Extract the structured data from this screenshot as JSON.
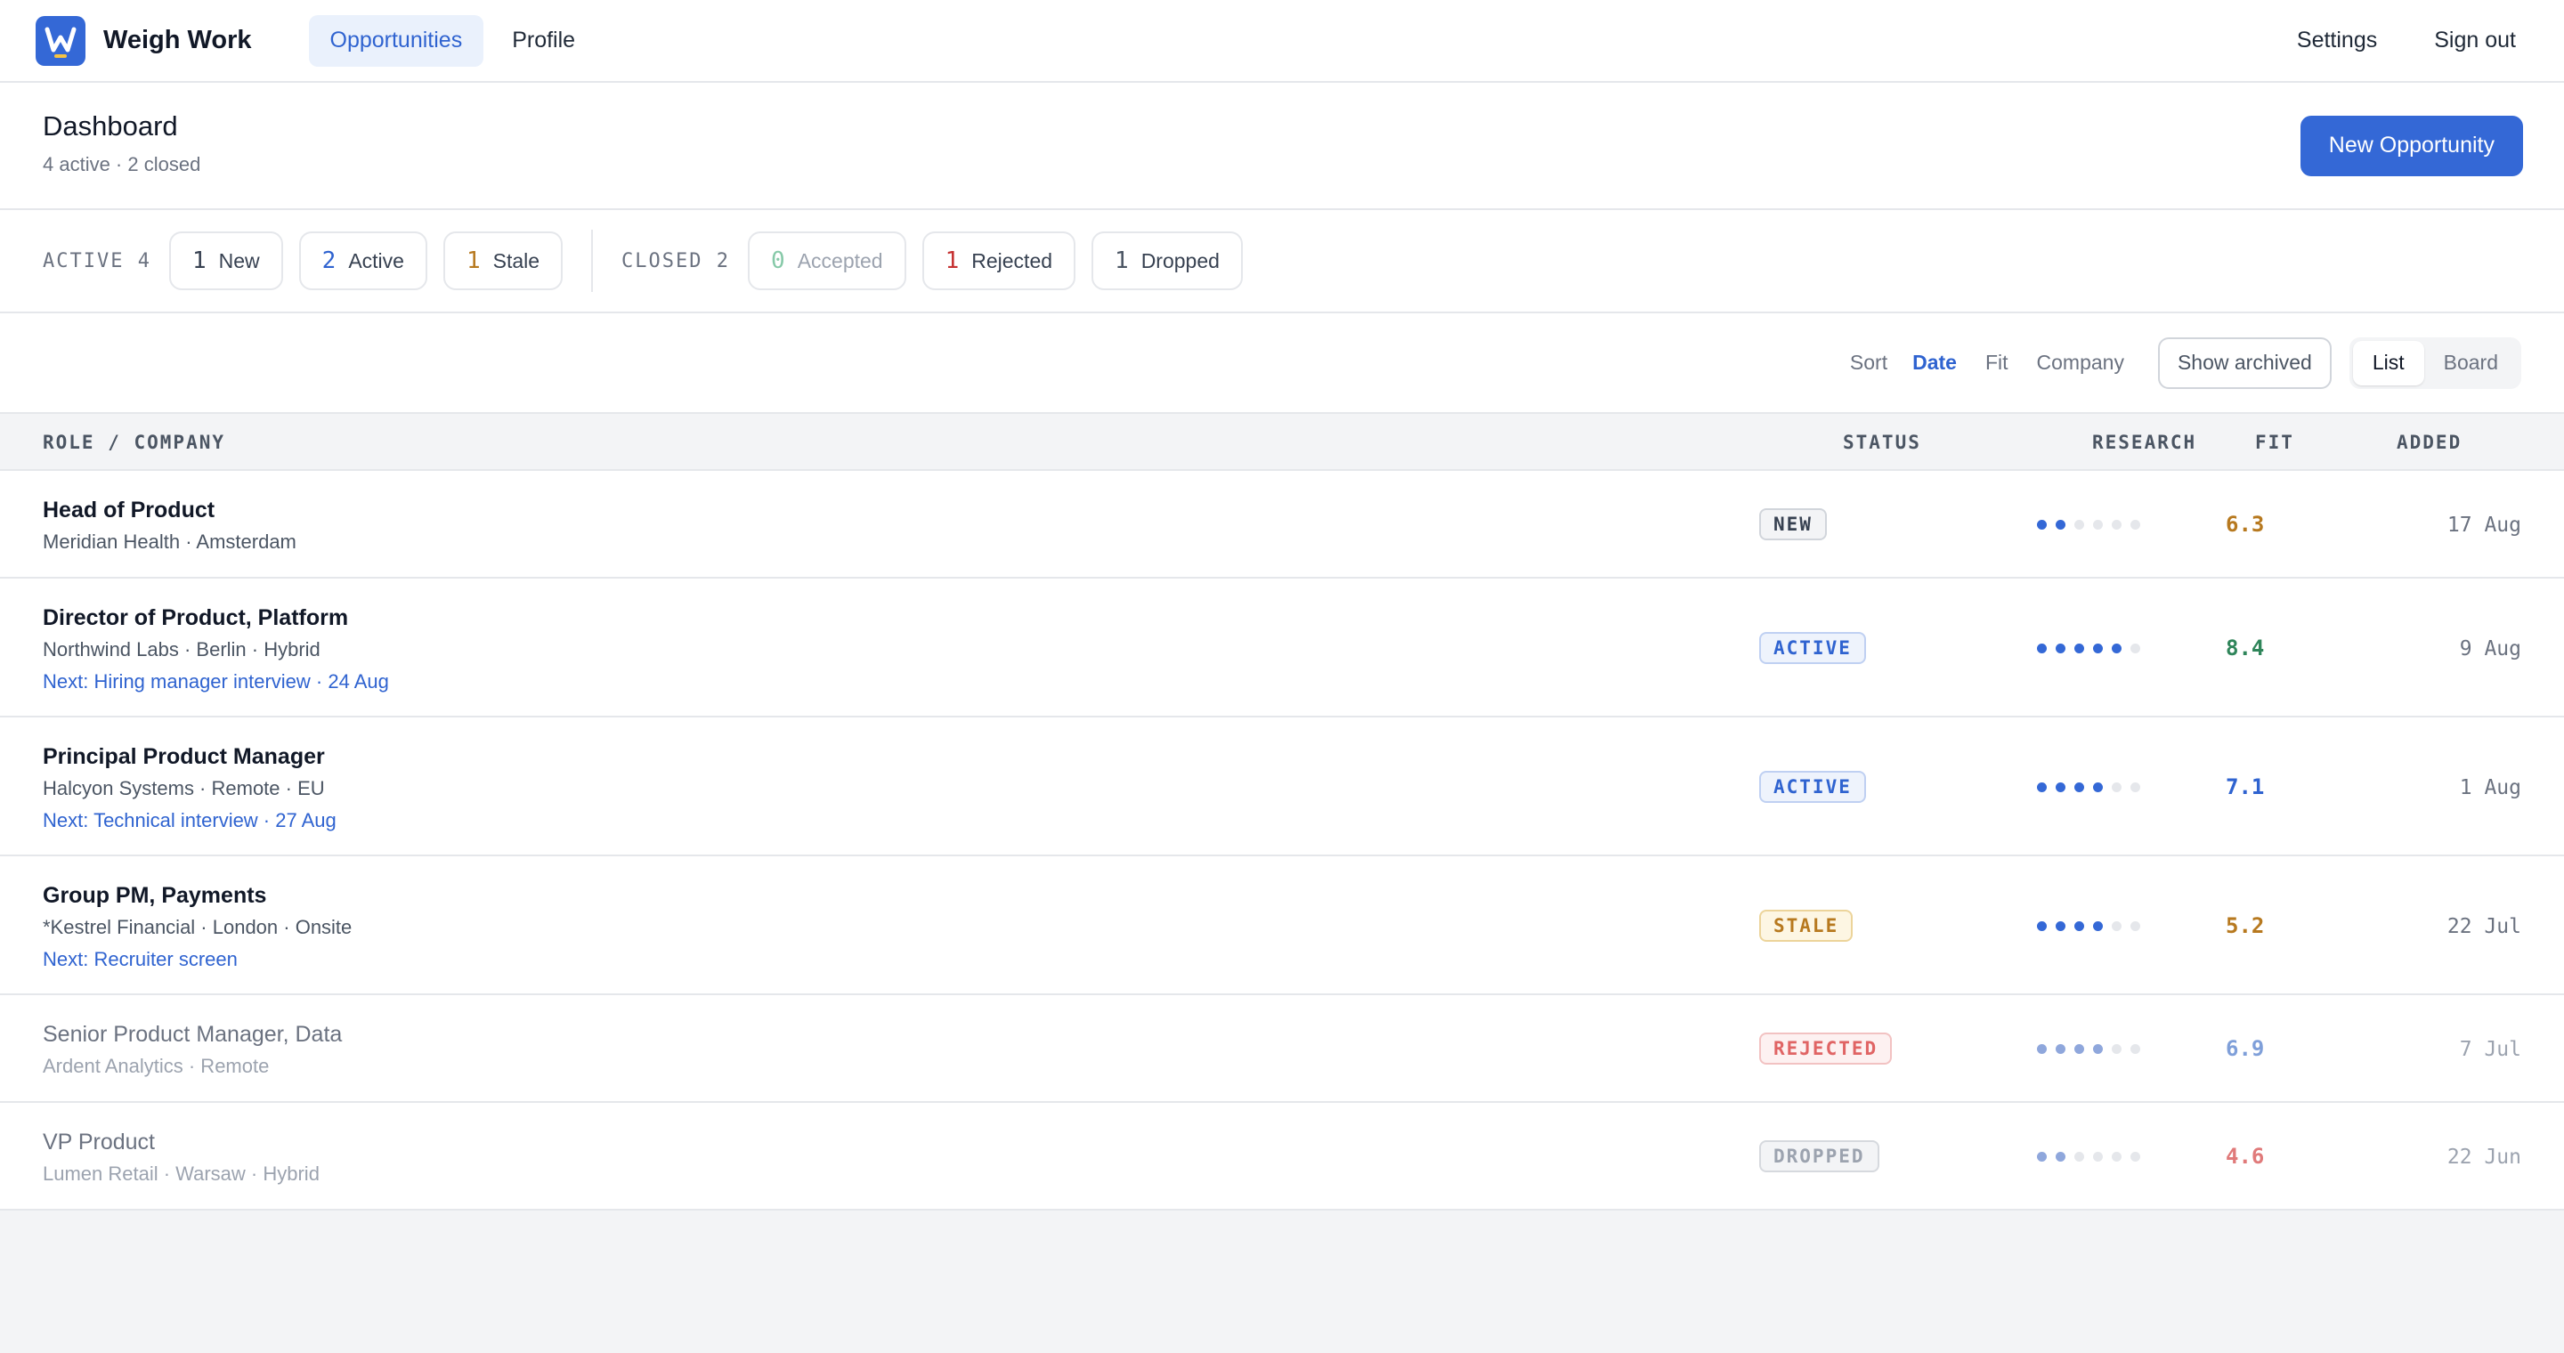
{
  "app": {
    "name": "Weigh Work",
    "logo_letter": "W",
    "brand_color": "#3468d6",
    "nav": [
      {
        "label": "Opportunities",
        "active": true
      },
      {
        "label": "Profile",
        "active": false
      }
    ],
    "top_links": [
      "Settings",
      "Sign out"
    ]
  },
  "header": {
    "title": "Dashboard",
    "subtitle": "4 active · 2 closed",
    "new_button": "New Opportunity"
  },
  "filters": {
    "active_label": "ACTIVE",
    "active_count": "4",
    "active_chips": [
      {
        "count": "1",
        "label": "New",
        "color": "#374151"
      },
      {
        "count": "2",
        "label": "Active",
        "color": "#2f63d0"
      },
      {
        "count": "1",
        "label": "Stale",
        "color": "#b7791f"
      }
    ],
    "closed_label": "CLOSED",
    "closed_count": "2",
    "closed_chips": [
      {
        "count": "0",
        "label": "Accepted",
        "color": "#86c9a8"
      },
      {
        "count": "1",
        "label": "Rejected",
        "color": "#c53030"
      },
      {
        "count": "1",
        "label": "Dropped",
        "color": "#4b5563"
      }
    ]
  },
  "toolbar": {
    "sort_label": "Sort",
    "sort_options": [
      {
        "label": "Date",
        "selected": true
      },
      {
        "label": "Fit",
        "selected": false
      },
      {
        "label": "Company",
        "selected": false
      }
    ],
    "show_archived": "Show archived",
    "view_options": [
      {
        "label": "List",
        "selected": true
      },
      {
        "label": "Board",
        "selected": false
      }
    ]
  },
  "table": {
    "columns": {
      "role": "ROLE / COMPANY",
      "status": "STATUS",
      "research": "RESEARCH",
      "fit": "FIT",
      "added": "ADDED"
    },
    "rows": [
      {
        "title": "Head of Product",
        "meta": "Meridian Health · Amsterdam",
        "next": "",
        "status": "NEW",
        "research_level": 2,
        "fit": "6.3",
        "added": "17 Aug",
        "dim": false
      },
      {
        "title": "Director of Product, Platform",
        "meta": "Northwind Labs · Berlin · Hybrid",
        "next": "Next: Hiring manager interview · 24 Aug",
        "status": "ACTIVE",
        "research_level": 5,
        "fit": "8.4",
        "added": "9 Aug",
        "dim": false
      },
      {
        "title": "Principal Product Manager",
        "meta": "Halcyon Systems · Remote · EU",
        "next": "Next: Technical interview · 27 Aug",
        "status": "ACTIVE",
        "research_level": 4,
        "fit": "7.1",
        "added": "1 Aug",
        "dim": false
      },
      {
        "title": "Group PM, Payments",
        "meta": "*Kestrel Financial · London · Onsite",
        "next": "Next: Recruiter screen",
        "status": "STALE",
        "research_level": 4,
        "fit": "5.2",
        "added": "22 Jul",
        "dim": false
      },
      {
        "title": "Senior Product Manager, Data",
        "meta": "Ardent Analytics · Remote",
        "next": "",
        "status": "REJECTED",
        "research_level": 4,
        "fit": "6.9",
        "added": "7 Jul",
        "dim": true
      },
      {
        "title": "VP Product",
        "meta": "Lumen Retail · Warsaw · Hybrid",
        "next": "",
        "status": "DROPPED",
        "research_level": 2,
        "fit": "4.6",
        "added": "22 Jun",
        "dim": true
      }
    ],
    "research_max": 6,
    "status_styles": {
      "NEW": {
        "text": "#374151",
        "bg": "#f3f4f6",
        "border": "#d1d5db"
      },
      "ACTIVE": {
        "text": "#2f63d0",
        "bg": "#eef3fc",
        "border": "#bfd0f2"
      },
      "STALE": {
        "text": "#b7791f",
        "bg": "#fdf6e3",
        "border": "#ecd49a"
      },
      "REJECTED": {
        "text": "#e06464",
        "bg": "#fdf1f1",
        "border": "#f2c2c2"
      },
      "DROPPED": {
        "text": "#9ca3af",
        "bg": "#f3f4f6",
        "border": "#d6d9de"
      }
    },
    "fit_colors": {
      "6.3": "#b7791f",
      "8.4": "#2f855a",
      "7.1": "#2f63d0",
      "5.2": "#b7791f",
      "6.9": "#7f9fd9",
      "4.6": "#e07a7a"
    }
  }
}
